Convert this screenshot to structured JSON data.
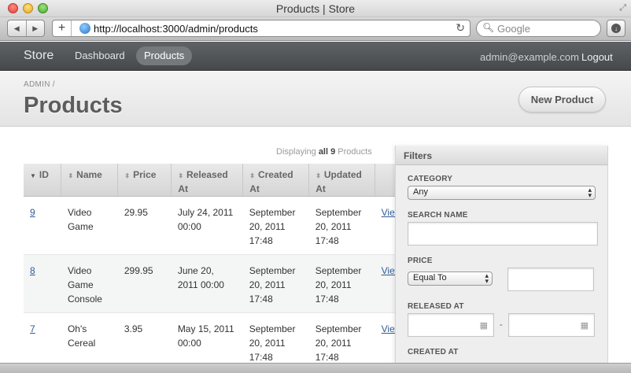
{
  "window": {
    "title": "Products | Store"
  },
  "browser": {
    "url": "http://localhost:3000/admin/products",
    "search_placeholder": "Google"
  },
  "nav": {
    "brand": "Store",
    "links": [
      "Dashboard",
      "Products"
    ],
    "active": "Products",
    "user_email": "admin@example.com",
    "logout": "Logout"
  },
  "header": {
    "breadcrumb": "ADMIN /",
    "title": "Products",
    "new_button": "New Product"
  },
  "list": {
    "displaying_prefix": "Displaying",
    "displaying_all": "all 9",
    "displaying_suffix": "Products",
    "columns": [
      {
        "label": "ID",
        "sort": "▼"
      },
      {
        "label": "Name",
        "sort": "⬍"
      },
      {
        "label": "Price",
        "sort": "⬍"
      },
      {
        "label": "Released At",
        "sort": "⬍"
      },
      {
        "label": "Created At",
        "sort": "⬍"
      },
      {
        "label": "Updated At",
        "sort": "⬍"
      }
    ],
    "rows": [
      {
        "id": "9",
        "name": "Video Game",
        "price": "29.95",
        "released": "July 24, 2011 00:00",
        "created": "September 20, 2011 17:48",
        "updated": "September 20, 2011 17:48",
        "action": "View"
      },
      {
        "id": "8",
        "name": "Video Game Console",
        "price": "299.95",
        "released": "June 20, 2011 00:00",
        "created": "September 20, 2011 17:48",
        "updated": "September 20, 2011 17:48",
        "action": "View"
      },
      {
        "id": "7",
        "name": "Oh's Cereal",
        "price": "3.95",
        "released": "May 15, 2011 00:00",
        "created": "September 20, 2011 17:48",
        "updated": "September 20, 2011 17:48",
        "action": "View"
      }
    ]
  },
  "filters": {
    "title": "Filters",
    "category_label": "CATEGORY",
    "category_value": "Any",
    "search_name_label": "SEARCH NAME",
    "search_name_value": "",
    "price_label": "PRICE",
    "price_operator": "Equal To",
    "price_value": "",
    "released_label": "RELEASED AT",
    "range_separator": "-",
    "created_label": "CREATED AT"
  }
}
